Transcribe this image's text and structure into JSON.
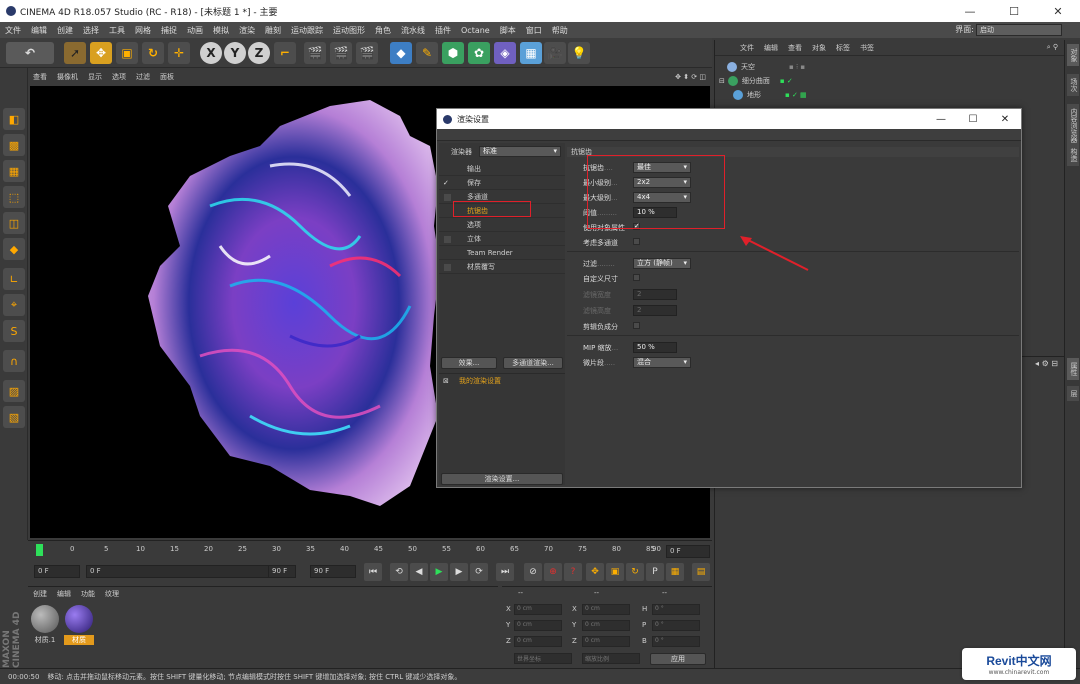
{
  "window": {
    "title": "CINEMA 4D R18.057 Studio (RC - R18) - [未标题 1 *] - 主要"
  },
  "menu": {
    "items": [
      "文件",
      "编辑",
      "创建",
      "选择",
      "工具",
      "网格",
      "捕捉",
      "动画",
      "模拟",
      "渲染",
      "雕刻",
      "运动跟踪",
      "运动图形",
      "角色",
      "流水线",
      "插件",
      "Octane",
      "脚本",
      "窗口",
      "帮助"
    ],
    "layout_label": "界面:",
    "layout_value": "启动"
  },
  "viewport": {
    "menu": [
      "查看",
      "摄像机",
      "显示",
      "选项",
      "过滤",
      "面板"
    ]
  },
  "timeline": {
    "ticks": [
      "0",
      "5",
      "10",
      "15",
      "20",
      "25",
      "30",
      "35",
      "40",
      "45",
      "50",
      "55",
      "60",
      "65",
      "70",
      "75",
      "80",
      "85",
      "90"
    ],
    "frame_end": "0 F"
  },
  "frames": {
    "start": "0 F",
    "min": "0 F",
    "max": "90 F",
    "end": "90 F"
  },
  "materials": {
    "tabs": [
      "创建",
      "编辑",
      "功能",
      "纹理"
    ],
    "items": [
      {
        "name": "材质.1"
      },
      {
        "name": "材质"
      }
    ]
  },
  "coords": {
    "headers": [
      "--",
      "--",
      "--"
    ],
    "rows": [
      {
        "a": "X",
        "av": "0 cm",
        "b": "X",
        "bv": "0 cm",
        "c": "H",
        "cv": "0 °"
      },
      {
        "a": "Y",
        "av": "0 cm",
        "b": "Y",
        "bv": "0 cm",
        "c": "P",
        "cv": "0 °"
      },
      {
        "a": "Z",
        "av": "0 cm",
        "b": "Z",
        "bv": "0 cm",
        "c": "B",
        "cv": "0 °"
      }
    ],
    "world": "世界坐标",
    "scale": "缩放比例",
    "apply": "应用"
  },
  "objects": {
    "menu": [
      "文件",
      "编辑",
      "查看",
      "对象",
      "标签",
      "书签"
    ],
    "items": [
      "天空",
      "细分曲面",
      "地形"
    ]
  },
  "side_tabs": [
    "对象",
    "场次",
    "内容浏览器",
    "构造",
    "属性",
    "层"
  ],
  "status": {
    "time": "00:00:50",
    "text": "移动: 点击并拖动鼠标移动元素。按住 SHIFT 键量化移动; 节点编辑模式时按住 SHIFT 键增加选择对象; 按住 CTRL 键减少选择对象。"
  },
  "dialog": {
    "title": "渲染设置",
    "renderer_label": "渲染器",
    "renderer_value": "标准",
    "nav": [
      {
        "label": "输出",
        "check": ""
      },
      {
        "label": "保存",
        "check": "✓"
      },
      {
        "label": "多通道",
        "check": "box"
      },
      {
        "label": "抗锯齿",
        "check": ""
      },
      {
        "label": "选项",
        "check": ""
      },
      {
        "label": "立体",
        "check": "box"
      },
      {
        "label": "Team Render",
        "check": ""
      },
      {
        "label": "材质覆写",
        "check": "box"
      }
    ],
    "effects_button": "效果...",
    "multipass_button": "多通道渲染...",
    "preset": "我的渲染设置",
    "render_settings_button": "渲染设置...",
    "section_title": "抗锯齿",
    "antialias_label": "抗锯齿",
    "antialias_value": "最佳",
    "min_level_label": "最小级别",
    "min_level_value": "2x2",
    "max_level_label": "最大级别",
    "max_level_value": "4x4",
    "threshold_label": "阈值",
    "threshold_value": "10 %",
    "use_object_label": "使用对象属性",
    "consider_mp_label": "考虑多通道",
    "filter_label": "过滤",
    "filter_value": "立方 (静帧)",
    "custom_size_label": "自定义尺寸",
    "filter_width_label": "滤镜宽度",
    "filter_width_value": "2",
    "filter_height_label": "滤镜高度",
    "filter_height_value": "2",
    "clip_neg_label": "剪辑负成分",
    "mip_label": "MIP 缩放",
    "mip_value": "50 %",
    "micro_label": "微片段",
    "micro_value": "混合"
  },
  "watermark": {
    "brand": "Revit中文网",
    "url": "www.chinarevit.com"
  },
  "colors": {
    "accent": "#ffa800",
    "highlight": "#e0202a",
    "dialog_bg": "#3a3a3a"
  }
}
